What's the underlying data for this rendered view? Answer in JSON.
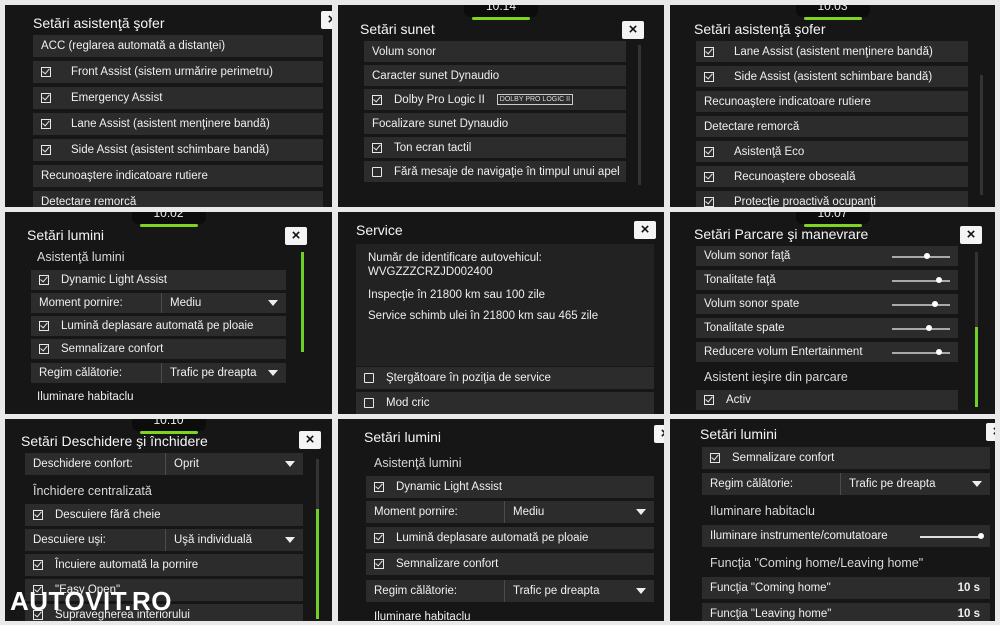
{
  "p1": {
    "title": "Setări asistenţă şofer",
    "close": "×",
    "rows": [
      "ACC (reglarea automată a distanţei)",
      "Front Assist (sistem urmărire perimetru)",
      "Emergency Assist",
      "Lane Assist (asistent menţinere bandă)",
      "Side Assist (asistent schimbare bandă)",
      "Recunoaştere indicatoare rutiere",
      "Detectare remorcă"
    ]
  },
  "p2": {
    "clock": "10:14",
    "title": "Setări sunet",
    "close": "×",
    "rows": [
      "Volum sonor",
      "Caracter sunet Dynaudio",
      "Dolby Pro Logic II",
      "Focalizare sunet Dynaudio",
      "Ton ecran tactil",
      "Fără mesaje de navigaţie în timpul unui apel"
    ],
    "dolby_logo": "DOLBY PRO LOGIC II"
  },
  "p3": {
    "clock": "10:03",
    "title": "Setări asistenţă şofer",
    "rows": [
      "Lane Assist (asistent menţinere bandă)",
      "Side Assist (asistent schimbare bandă)",
      "Recunoaştere indicatoare rutiere",
      "Detectare remorcă",
      "Asistenţă Eco",
      "Recunoaştere oboseală",
      "Protecţie proactivă ocupanţi"
    ]
  },
  "p4": {
    "clock": "10:02",
    "title": "Setări lumini",
    "close": "×",
    "section": "Asistenţă lumini",
    "rows": [
      "Dynamic Light Assist",
      "Moment pornire:",
      "Lumină deplasare automată pe ploaie",
      "Semnalizare confort",
      "Regim călătorie:",
      "Iluminare habitaclu"
    ],
    "moment_value": "Mediu",
    "regim_value": "Trafic pe dreapta"
  },
  "p5": {
    "title": "Service",
    "close": "×",
    "vin_label": "Număr de identificare autovehicul:",
    "vin": "WVGZZZCRZJD002400",
    "inspection": "Inspecţie în 21800 km sau 100 zile",
    "oil": "Service schimb ulei în 21800 km sau 465 zile",
    "rows": [
      "Ştergătoare în poziţia de service",
      "Mod cric"
    ]
  },
  "p6": {
    "clock": "10:07",
    "title": "Setări Parcare şi manevrare",
    "close": "×",
    "rows": [
      "Volum sonor faţă",
      "Tonalitate faţă",
      "Volum sonor spate",
      "Tonalitate spate",
      "Reducere volum Entertainment"
    ],
    "slider_levels": [
      0.55,
      0.75,
      0.7,
      0.6,
      0.75
    ],
    "section": "Asistent ieşire din parcare",
    "activ": "Activ"
  },
  "p7": {
    "clock": "10:10",
    "title": "Setări Deschidere şi închidere",
    "close": "×",
    "row_confort": "Deschidere confort:",
    "confort_value": "Oprit",
    "section": "Închidere centralizată",
    "row_descuiere": "Descuiere fără cheie",
    "row_usi": "Descuiere uşi:",
    "usi_value": "Uşă individuală",
    "row_incuiere": "Încuiere automată la pornire",
    "row_easy": "\"Easy Open\"",
    "row_supra": "Supravegherea interiorului"
  },
  "p8": {
    "title": "Setări lumini",
    "close": "×",
    "section": "Asistenţă lumini",
    "rows": [
      "Dynamic Light Assist",
      "Moment pornire:",
      "Lumină deplasare automată pe ploaie",
      "Semnalizare confort",
      "Regim călătorie:",
      "Iluminare habitaclu"
    ],
    "moment_value": "Mediu",
    "regim_value": "Trafic pe dreapta"
  },
  "p9": {
    "title": "Setări lumini",
    "close": "×",
    "row_semn": "Semnalizare confort",
    "row_regim": "Regim călătorie:",
    "regim_value": "Trafic pe dreapta",
    "section1": "Iluminare habitaclu",
    "row_instr": "Iluminare instrumente/comutatoare",
    "instr_level": 1.0,
    "section2": "Funcţia \"Coming home/Leaving home\"",
    "row_coming": "Funcţia \"Coming home\"",
    "coming_value": "10 s",
    "row_leaving": "Funcţia \"Leaving home\"",
    "leaving_value": "10 s"
  },
  "watermark": "AUTOVIT.RO"
}
